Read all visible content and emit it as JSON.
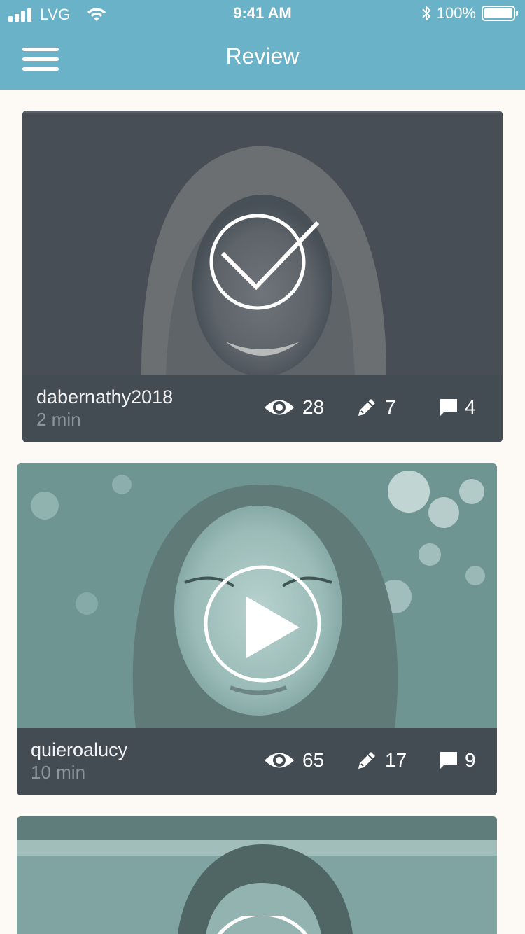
{
  "status_bar": {
    "carrier": "LVG",
    "time": "9:41 AM",
    "battery": "100%"
  },
  "header": {
    "title": "Review"
  },
  "cards": [
    {
      "username": "dabernathy2018",
      "duration": "2 min",
      "views": "28",
      "edits": "7",
      "comments": "4",
      "state": "check-circle-icon"
    },
    {
      "username": "quieroalucy",
      "duration": "10 min",
      "views": "65",
      "edits": "17",
      "comments": "9",
      "state": "play-circle-icon"
    }
  ],
  "colors": {
    "header_bg": "#6AB2C8",
    "footer_bg": "#434C53",
    "page_bg": "#FDF9F5"
  }
}
